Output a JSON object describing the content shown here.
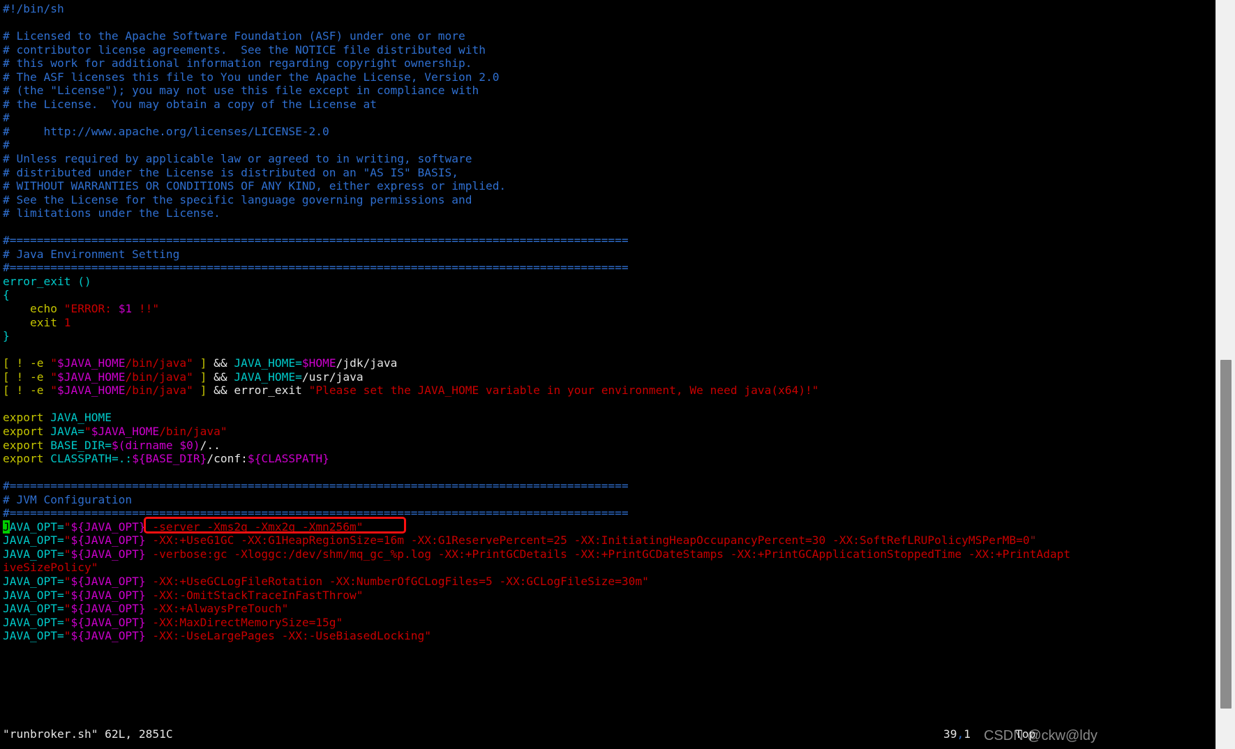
{
  "editor": {
    "app": "vim",
    "filename": "runbroker.sh",
    "background": "#000000",
    "cursor_color": "#00d000",
    "cursor_line": 39,
    "cursor_col": 1
  },
  "statusline": {
    "file_info": "\"runbroker.sh\" 62L, 2851C",
    "ruler_line": "39",
    "ruler_sep": ",",
    "ruler_col": "1",
    "position_flag": "Top"
  },
  "watermark": {
    "text": "CSDN @ckw@ldy"
  },
  "annotation": {
    "color": "#ff1010",
    "target_text": "-server -Xms2g -Xmx2g -Xmn256m\""
  },
  "palette": {
    "comment": "#2f6fd0",
    "keyword": "#c5c500",
    "identifier": "#00c8c8",
    "string": "#c90000",
    "variable": "#cc00cc",
    "plain": "#e6e6e6"
  },
  "lines": [
    {
      "n": 1,
      "segs": [
        {
          "c": "cm",
          "t": "#!/bin/sh"
        }
      ]
    },
    {
      "n": 2,
      "segs": []
    },
    {
      "n": 3,
      "segs": [
        {
          "c": "cm",
          "t": "# Licensed to the Apache Software Foundation (ASF) under one or more"
        }
      ]
    },
    {
      "n": 4,
      "segs": [
        {
          "c": "cm",
          "t": "# contributor license agreements.  See the NOTICE file distributed with"
        }
      ]
    },
    {
      "n": 5,
      "segs": [
        {
          "c": "cm",
          "t": "# this work for additional information regarding copyright ownership."
        }
      ]
    },
    {
      "n": 6,
      "segs": [
        {
          "c": "cm",
          "t": "# The ASF licenses this file to You under the Apache License, Version 2.0"
        }
      ]
    },
    {
      "n": 7,
      "segs": [
        {
          "c": "cm",
          "t": "# (the \"License\"); you may not use this file except in compliance with"
        }
      ]
    },
    {
      "n": 8,
      "segs": [
        {
          "c": "cm",
          "t": "# the License.  You may obtain a copy of the License at"
        }
      ]
    },
    {
      "n": 9,
      "segs": [
        {
          "c": "cm",
          "t": "#"
        }
      ]
    },
    {
      "n": 10,
      "segs": [
        {
          "c": "cm",
          "t": "#     http://www.apache.org/licenses/LICENSE-2.0"
        }
      ]
    },
    {
      "n": 11,
      "segs": [
        {
          "c": "cm",
          "t": "#"
        }
      ]
    },
    {
      "n": 12,
      "segs": [
        {
          "c": "cm",
          "t": "# Unless required by applicable law or agreed to in writing, software"
        }
      ]
    },
    {
      "n": 13,
      "segs": [
        {
          "c": "cm",
          "t": "# distributed under the License is distributed on an \"AS IS\" BASIS,"
        }
      ]
    },
    {
      "n": 14,
      "segs": [
        {
          "c": "cm",
          "t": "# WITHOUT WARRANTIES OR CONDITIONS OF ANY KIND, either express or implied."
        }
      ]
    },
    {
      "n": 15,
      "segs": [
        {
          "c": "cm",
          "t": "# See the License for the specific language governing permissions and"
        }
      ]
    },
    {
      "n": 16,
      "segs": [
        {
          "c": "cm",
          "t": "# limitations under the License."
        }
      ]
    },
    {
      "n": 17,
      "segs": []
    },
    {
      "n": 18,
      "segs": [
        {
          "c": "cm",
          "t": "#==========================================================================================="
        }
      ]
    },
    {
      "n": 19,
      "segs": [
        {
          "c": "cm",
          "t": "# Java Environment Setting"
        }
      ]
    },
    {
      "n": 20,
      "segs": [
        {
          "c": "cm",
          "t": "#==========================================================================================="
        }
      ]
    },
    {
      "n": 21,
      "segs": [
        {
          "c": "fn",
          "t": "error_exit ()"
        }
      ]
    },
    {
      "n": 22,
      "segs": [
        {
          "c": "fn",
          "t": "{"
        }
      ]
    },
    {
      "n": 23,
      "segs": [
        {
          "c": "op",
          "t": "    "
        },
        {
          "c": "kw",
          "t": "echo "
        },
        {
          "c": "str",
          "t": "\"ERROR: "
        },
        {
          "c": "var",
          "t": "$1"
        },
        {
          "c": "str",
          "t": " !!\""
        }
      ]
    },
    {
      "n": 24,
      "segs": [
        {
          "c": "op",
          "t": "    "
        },
        {
          "c": "kw",
          "t": "exit "
        },
        {
          "c": "num",
          "t": "1"
        }
      ]
    },
    {
      "n": 25,
      "segs": [
        {
          "c": "fn",
          "t": "}"
        }
      ]
    },
    {
      "n": 26,
      "segs": []
    },
    {
      "n": 27,
      "segs": [
        {
          "c": "kw",
          "t": "[ ! -e "
        },
        {
          "c": "str",
          "t": "\""
        },
        {
          "c": "var",
          "t": "$JAVA_HOME"
        },
        {
          "c": "str",
          "t": "/bin/java\""
        },
        {
          "c": "kw",
          "t": " ] "
        },
        {
          "c": "op",
          "t": "&& "
        },
        {
          "c": "id",
          "t": "JAVA_HOME="
        },
        {
          "c": "var",
          "t": "$HOME"
        },
        {
          "c": "op",
          "t": "/jdk/java"
        }
      ]
    },
    {
      "n": 28,
      "segs": [
        {
          "c": "kw",
          "t": "[ ! -e "
        },
        {
          "c": "str",
          "t": "\""
        },
        {
          "c": "var",
          "t": "$JAVA_HOME"
        },
        {
          "c": "str",
          "t": "/bin/java\""
        },
        {
          "c": "kw",
          "t": " ] "
        },
        {
          "c": "op",
          "t": "&& "
        },
        {
          "c": "id",
          "t": "JAVA_HOME="
        },
        {
          "c": "op",
          "t": "/usr/java"
        }
      ]
    },
    {
      "n": 29,
      "segs": [
        {
          "c": "kw",
          "t": "[ ! -e "
        },
        {
          "c": "str",
          "t": "\""
        },
        {
          "c": "var",
          "t": "$JAVA_HOME"
        },
        {
          "c": "str",
          "t": "/bin/java\""
        },
        {
          "c": "kw",
          "t": " ] "
        },
        {
          "c": "op",
          "t": "&& error_exit "
        },
        {
          "c": "str",
          "t": "\"Please set the JAVA_HOME variable in your environment, We need java(x64)!\""
        }
      ]
    },
    {
      "n": 30,
      "segs": []
    },
    {
      "n": 31,
      "segs": [
        {
          "c": "kw",
          "t": "export "
        },
        {
          "c": "id",
          "t": "JAVA_HOME"
        }
      ]
    },
    {
      "n": 32,
      "segs": [
        {
          "c": "kw",
          "t": "export "
        },
        {
          "c": "id",
          "t": "JAVA="
        },
        {
          "c": "str",
          "t": "\""
        },
        {
          "c": "var",
          "t": "$JAVA_HOME"
        },
        {
          "c": "str",
          "t": "/bin/java\""
        }
      ]
    },
    {
      "n": 33,
      "segs": [
        {
          "c": "kw",
          "t": "export "
        },
        {
          "c": "id",
          "t": "BASE_DIR="
        },
        {
          "c": "var",
          "t": "$(dirname $0)"
        },
        {
          "c": "op",
          "t": "/.."
        }
      ]
    },
    {
      "n": 34,
      "segs": [
        {
          "c": "kw",
          "t": "export "
        },
        {
          "c": "id",
          "t": "CLASSPATH=.:"
        },
        {
          "c": "var",
          "t": "${BASE_DIR}"
        },
        {
          "c": "op",
          "t": "/conf:"
        },
        {
          "c": "var",
          "t": "${CLASSPATH}"
        }
      ]
    },
    {
      "n": 35,
      "segs": []
    },
    {
      "n": 36,
      "segs": [
        {
          "c": "cm",
          "t": "#==========================================================================================="
        }
      ]
    },
    {
      "n": 37,
      "segs": [
        {
          "c": "cm",
          "t": "# JVM Configuration"
        }
      ]
    },
    {
      "n": 38,
      "segs": [
        {
          "c": "cm",
          "t": "#==========================================================================================="
        }
      ]
    },
    {
      "n": 39,
      "cursor": true,
      "segs": [
        {
          "c": "id cursor",
          "t": "J"
        },
        {
          "c": "id",
          "t": "AVA_OPT="
        },
        {
          "c": "str",
          "t": "\""
        },
        {
          "c": "var",
          "t": "${JAVA_OPT}"
        },
        {
          "c": "str",
          "t": " -server -Xms2g -Xmx2g -Xmn256m\""
        }
      ]
    },
    {
      "n": 40,
      "segs": [
        {
          "c": "id",
          "t": "JAVA_OPT="
        },
        {
          "c": "str",
          "t": "\""
        },
        {
          "c": "var",
          "t": "${JAVA_OPT}"
        },
        {
          "c": "str",
          "t": " -XX:+UseG1GC -XX:G1HeapRegionSize=16m -XX:G1ReservePercent=25 -XX:InitiatingHeapOccupancyPercent=30 -XX:SoftRefLRUPolicyMSPerMB=0"
        },
        {
          "c": "qd",
          "t": "\""
        }
      ]
    },
    {
      "n": 41,
      "segs": [
        {
          "c": "id",
          "t": "JAVA_OPT="
        },
        {
          "c": "str",
          "t": "\""
        },
        {
          "c": "var",
          "t": "${JAVA_OPT}"
        },
        {
          "c": "str",
          "t": " -verbose:gc -Xloggc:/dev/shm/mq_gc_%p.log -XX:+PrintGCDetails -XX:+PrintGCDateStamps -XX:+PrintGCApplicationStoppedTime -XX:+PrintAdapt"
        }
      ]
    },
    {
      "n": 42,
      "wrap": true,
      "segs": [
        {
          "c": "str",
          "t": "iveSizePolicy\""
        }
      ]
    },
    {
      "n": 43,
      "segs": [
        {
          "c": "id",
          "t": "JAVA_OPT="
        },
        {
          "c": "str",
          "t": "\""
        },
        {
          "c": "var",
          "t": "${JAVA_OPT}"
        },
        {
          "c": "str",
          "t": " -XX:+UseGCLogFileRotation -XX:NumberOfGCLogFiles=5 -XX:GCLogFileSize=30m\""
        }
      ]
    },
    {
      "n": 44,
      "segs": [
        {
          "c": "id",
          "t": "JAVA_OPT="
        },
        {
          "c": "str",
          "t": "\""
        },
        {
          "c": "var",
          "t": "${JAVA_OPT}"
        },
        {
          "c": "str",
          "t": " -XX:-OmitStackTraceInFastThrow\""
        }
      ]
    },
    {
      "n": 45,
      "segs": [
        {
          "c": "id",
          "t": "JAVA_OPT="
        },
        {
          "c": "str",
          "t": "\""
        },
        {
          "c": "var",
          "t": "${JAVA_OPT}"
        },
        {
          "c": "str",
          "t": " -XX:+AlwaysPreTouch\""
        }
      ]
    },
    {
      "n": 46,
      "segs": [
        {
          "c": "id",
          "t": "JAVA_OPT="
        },
        {
          "c": "str",
          "t": "\""
        },
        {
          "c": "var",
          "t": "${JAVA_OPT}"
        },
        {
          "c": "str",
          "t": " -XX:MaxDirectMemorySize=15g\""
        }
      ]
    },
    {
      "n": 47,
      "segs": [
        {
          "c": "id",
          "t": "JAVA_OPT="
        },
        {
          "c": "str",
          "t": "\""
        },
        {
          "c": "var",
          "t": "${JAVA_OPT}"
        },
        {
          "c": "str",
          "t": " -XX:-UseLargePages -XX:-UseBiasedLocking\""
        }
      ]
    }
  ]
}
